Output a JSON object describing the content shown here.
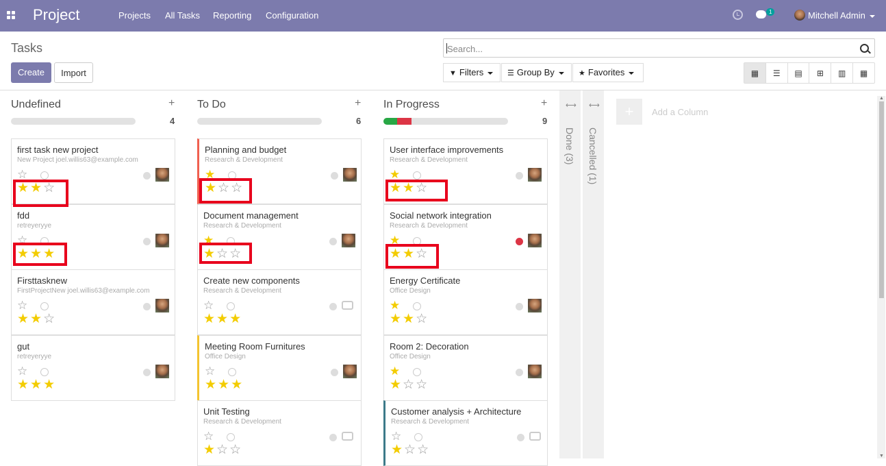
{
  "nav": {
    "brand": "Project",
    "menus": [
      "Projects",
      "All Tasks",
      "Reporting",
      "Configuration"
    ],
    "chat_badge": "1",
    "user": "Mitchell Admin"
  },
  "cp": {
    "title": "Tasks",
    "create": "Create",
    "import": "Import",
    "search_placeholder": "Search...",
    "filters": "Filters",
    "groupby": "Group By",
    "favorites": "Favorites"
  },
  "columns": [
    {
      "name": "Undefined",
      "count": "4"
    },
    {
      "name": "To Do",
      "count": "6"
    },
    {
      "name": "In Progress",
      "count": "9"
    }
  ],
  "folded": [
    "Done (3)",
    "Cancelled (1)"
  ],
  "add_column": "Add a Column",
  "cards": {
    "c1": {
      "title": "first task new project",
      "sub": "New Project joel.willis63@example.com",
      "rating": 2
    },
    "c2": {
      "title": "fdd",
      "sub": "retreyeryye",
      "rating": 3
    },
    "c3": {
      "title": "Firsttasknew",
      "sub": "FirstProjectNew joel.willis63@example.com",
      "rating": 2
    },
    "c4": {
      "title": "gut",
      "sub": "retreyeryye",
      "rating": 3
    },
    "c5": {
      "title": "Planning and budget",
      "sub": "Research & Development",
      "rating": 1
    },
    "c6": {
      "title": "Document management",
      "sub": "Research & Development",
      "rating": 1
    },
    "c7": {
      "title": "Create new components",
      "sub": "Research & Development",
      "rating": 3
    },
    "c8": {
      "title": "Meeting Room Furnitures",
      "sub": "Office Design",
      "rating": 3
    },
    "c9": {
      "title": "Unit Testing",
      "sub": "Research & Development",
      "rating": 1
    },
    "c10": {
      "title": "User interface improvements",
      "sub": "Research & Development",
      "rating": 2
    },
    "c11": {
      "title": "Social network integration",
      "sub": "Research & Development",
      "rating": 2
    },
    "c12": {
      "title": "Energy Certificate",
      "sub": "Office Design",
      "rating": 2
    },
    "c13": {
      "title": "Room 2: Decoration",
      "sub": "Office Design",
      "rating": 1
    },
    "c14": {
      "title": "Customer analysis + Architecture",
      "sub": "Research & Development",
      "rating": 1
    }
  }
}
